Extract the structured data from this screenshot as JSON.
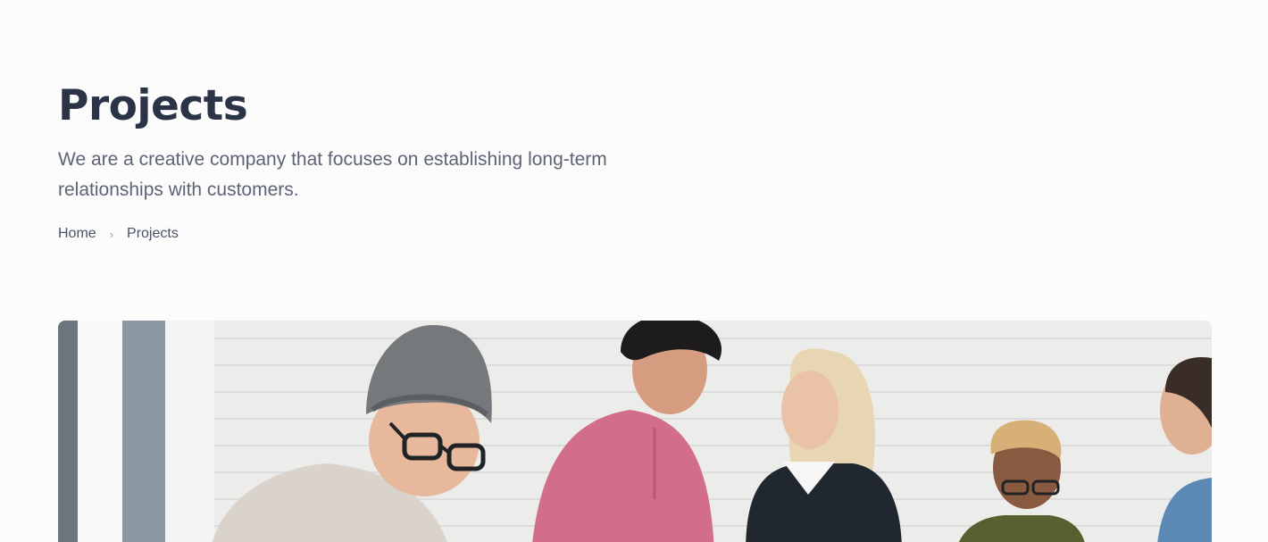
{
  "header": {
    "title": "Projects",
    "subtitle": "We are a creative company that focuses on establishing long-term relationships with customers."
  },
  "breadcrumb": {
    "items": [
      "Home",
      "Projects"
    ],
    "separator": "›"
  },
  "hero_image": {
    "alt": "",
    "colors": {
      "wall": "#ececeb",
      "window_frame": "#7f8891",
      "beanie": "#6f7274",
      "pink_shirt": "#d36e8a",
      "dark_top": "#20272f",
      "olive_top": "#5a5f32",
      "denim": "#5b8ab4"
    }
  }
}
